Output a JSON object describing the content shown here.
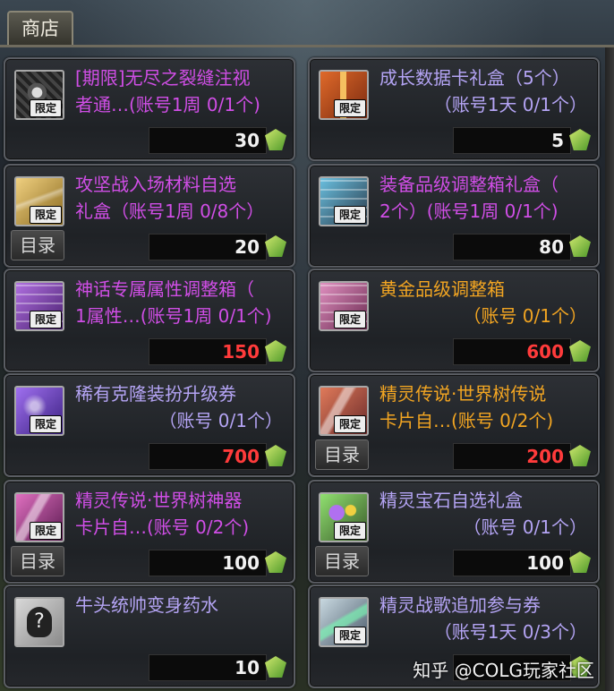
{
  "shop": {
    "title": "商店"
  },
  "items": [
    {
      "id": 1,
      "name_line1": "[期限]无尽之裂缝注视",
      "name_line2": "者通…(账号1周 0/1个)",
      "name_color": "purple",
      "price": "30",
      "price_color": "white",
      "limited_badge": "限定",
      "catalog_label": "",
      "icon": "rift-eye-icon"
    },
    {
      "id": 2,
      "name_line1": "成长数据卡礼盒（5个）",
      "name_line2": "（账号1天 0/1个）",
      "name_color": "lavender",
      "price": "5",
      "price_color": "white",
      "limited_badge": "限定",
      "catalog_label": "",
      "icon": "gift-box-icon"
    },
    {
      "id": 3,
      "name_line1": "攻坚战入场材料自选",
      "name_line2": "礼盒（账号1周 0/8个）",
      "name_color": "purple",
      "price": "20",
      "price_color": "white",
      "limited_badge": "限定",
      "catalog_label": "目录",
      "icon": "gold-box-icon"
    },
    {
      "id": 4,
      "name_line1": "装备品级调整箱礼盒（",
      "name_line2": "2个）(账号1周 0/1个)",
      "name_color": "purple",
      "price": "80",
      "price_color": "white",
      "limited_badge": "限定",
      "catalog_label": "",
      "icon": "adjust-box-icon"
    },
    {
      "id": 5,
      "name_line1": "神话专属属性调整箱（",
      "name_line2": "1属性…(账号1周 0/1个)",
      "name_color": "purple",
      "price": "150",
      "price_color": "red",
      "limited_badge": "限定",
      "catalog_label": "",
      "icon": "myth-box-icon"
    },
    {
      "id": 6,
      "name_line1": "黄金品级调整箱",
      "name_line2": "（账号 0/1个）",
      "name_color": "orange",
      "price": "600",
      "price_color": "red",
      "limited_badge": "限定",
      "catalog_label": "",
      "icon": "gold-adjust-box-icon"
    },
    {
      "id": 7,
      "name_line1": "稀有克隆装扮升级券",
      "name_line2": "（账号 0/1个）",
      "name_color": "lavender",
      "price": "700",
      "price_color": "red",
      "limited_badge": "限定",
      "catalog_label": "",
      "icon": "ticket-icon"
    },
    {
      "id": 8,
      "name_line1": "精灵传说·世界树传说",
      "name_line2": "卡片自…(账号 0/2个)",
      "name_color": "orange",
      "price": "200",
      "price_color": "red",
      "limited_badge": "限定",
      "catalog_label": "目录",
      "icon": "card-icon"
    },
    {
      "id": 9,
      "name_line1": "精灵传说·世界树神器",
      "name_line2": "卡片自…(账号 0/2个)",
      "name_color": "purple",
      "price": "100",
      "price_color": "white",
      "limited_badge": "限定",
      "catalog_label": "目录",
      "icon": "card-purple-icon"
    },
    {
      "id": 10,
      "name_line1": "精灵宝石自选礼盒",
      "name_line2": "（账号 0/1个）",
      "name_color": "lavender",
      "price": "100",
      "price_color": "white",
      "limited_badge": "限定",
      "catalog_label": "目录",
      "icon": "gem-box-icon"
    },
    {
      "id": 11,
      "name_line1": "牛头统帅变身药水",
      "name_line2": "",
      "name_color": "lavender",
      "price": "10",
      "price_color": "white",
      "limited_badge": "",
      "catalog_label": "",
      "icon": "potion-icon"
    },
    {
      "id": 12,
      "name_line1": "精灵战歌追加参与券",
      "name_line2": "（账号1天 0/3个）",
      "name_color": "lavender",
      "price": "",
      "price_color": "white",
      "limited_badge": "限定",
      "catalog_label": "",
      "icon": "ticket-green-icon"
    }
  ],
  "watermark": "知乎 @COLG玩家社区"
}
